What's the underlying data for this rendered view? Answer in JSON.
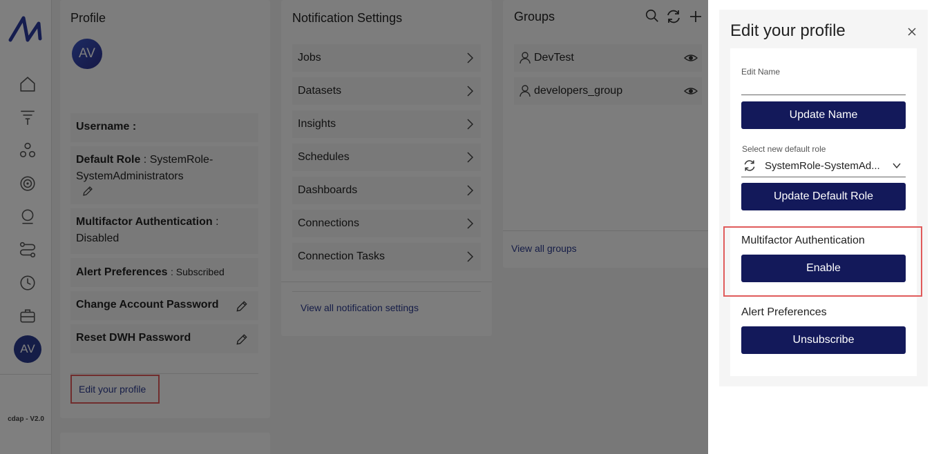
{
  "sidebar": {
    "avatar_initials": "AV",
    "version": "cdap - V2.0",
    "icons": [
      "home-icon",
      "funnel-icon",
      "network-icon",
      "target-icon",
      "robot-icon",
      "workflow-icon",
      "clock-icon",
      "briefcase-icon"
    ]
  },
  "profile": {
    "title": "Profile",
    "avatar_initials": "AV",
    "username_label": "Username :",
    "default_role_label": "Default Role",
    "default_role_value": ": SystemRole-SystemAdministrators",
    "mfa_label": "Multifactor Authentication",
    "mfa_value": ": Disabled",
    "alert_label": "Alert Preferences",
    "alert_value": ": Subscribed",
    "change_password_label": "Change Account Password",
    "reset_dwh_label": "Reset DWH Password",
    "edit_link": "Edit your profile"
  },
  "notifications": {
    "title": "Notification Settings",
    "items": [
      "Jobs",
      "Datasets",
      "Insights",
      "Schedules",
      "Dashboards",
      "Connections",
      "Connection Tasks"
    ],
    "link": "View all notification settings"
  },
  "groups": {
    "title": "Groups",
    "items": [
      "DevTest",
      "developers_group"
    ],
    "link": "View all groups"
  },
  "drawer": {
    "title": "Edit your profile",
    "edit_name_label": "Edit Name",
    "edit_name_value": "",
    "update_name_button": "Update Name",
    "role_select_label": "Select new default role",
    "role_selected": "SystemRole-SystemAd...",
    "update_role_button": "Update Default Role",
    "mfa_heading": "Multifactor Authentication",
    "mfa_button": "Enable",
    "alert_heading": "Alert Preferences",
    "alert_button": "Unsubscribe"
  },
  "colors": {
    "primary_button": "#13195a",
    "link": "#2b3a8f",
    "highlight_box": "#e05a5a"
  }
}
